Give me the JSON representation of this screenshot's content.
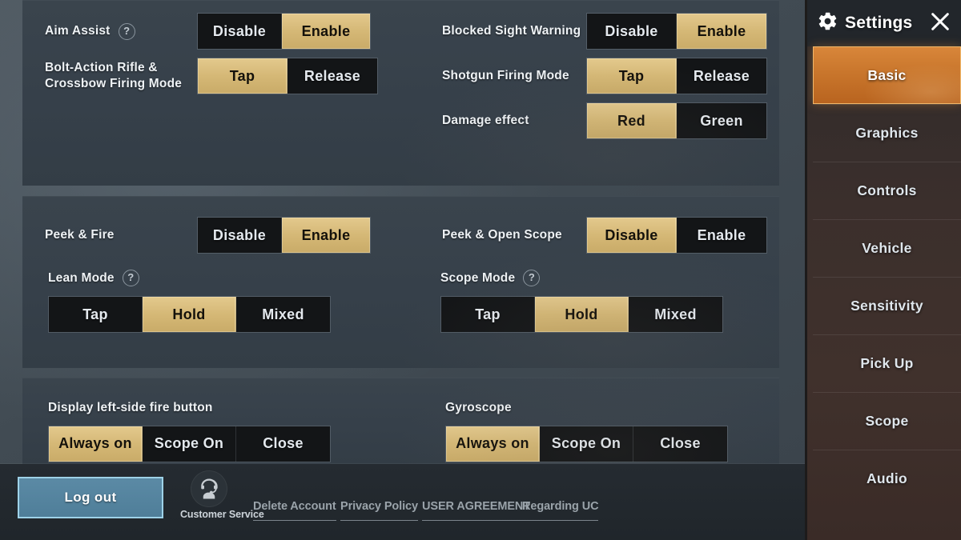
{
  "colors": {
    "gold": "#d5b876",
    "panel_bg": "#36404a",
    "sidebar_active": "#c9762c",
    "logout_blue": "#4f7e99"
  },
  "sidebar": {
    "title": "Settings",
    "gear_icon": "gear-icon",
    "close_icon": "close-icon",
    "items": [
      {
        "label": "Basic",
        "active": true
      },
      {
        "label": "Graphics",
        "active": false
      },
      {
        "label": "Controls",
        "active": false
      },
      {
        "label": "Vehicle",
        "active": false
      },
      {
        "label": "Sensitivity",
        "active": false
      },
      {
        "label": "Pick Up",
        "active": false
      },
      {
        "label": "Scope",
        "active": false
      },
      {
        "label": "Audio",
        "active": false
      }
    ]
  },
  "panels": [
    {
      "left": [
        {
          "label": "Aim Assist",
          "help": "?",
          "options": [
            {
              "text": "Disable",
              "selected": false
            },
            {
              "text": "Enable",
              "selected": true
            }
          ]
        },
        {
          "label": "Bolt-Action Rifle &\nCrossbow Firing Mode",
          "help": null,
          "options": [
            {
              "text": "Tap",
              "selected": true
            },
            {
              "text": "Release",
              "selected": false
            }
          ]
        }
      ],
      "right": [
        {
          "label": "Blocked Sight Warning",
          "help": null,
          "options": [
            {
              "text": "Disable",
              "selected": false
            },
            {
              "text": "Enable",
              "selected": true
            }
          ]
        },
        {
          "label": "Shotgun Firing Mode",
          "help": null,
          "options": [
            {
              "text": "Tap",
              "selected": true
            },
            {
              "text": "Release",
              "selected": false
            }
          ]
        },
        {
          "label": "Damage effect",
          "help": null,
          "options": [
            {
              "text": "Red",
              "selected": true
            },
            {
              "text": "Green",
              "selected": false
            }
          ]
        }
      ]
    },
    {
      "left": [
        {
          "label": "Peek & Fire",
          "help": null,
          "options": [
            {
              "text": "Disable",
              "selected": false
            },
            {
              "text": "Enable",
              "selected": true
            }
          ]
        },
        {
          "label": "Lean Mode",
          "help": "?",
          "options": [
            {
              "text": "Tap",
              "selected": false
            },
            {
              "text": "Hold",
              "selected": true
            },
            {
              "text": "Mixed",
              "selected": false
            }
          ]
        }
      ],
      "right": [
        {
          "label": "Peek & Open Scope",
          "help": null,
          "options": [
            {
              "text": "Disable",
              "selected": true
            },
            {
              "text": "Enable",
              "selected": false
            }
          ]
        },
        {
          "label": "Scope Mode",
          "help": "?",
          "options": [
            {
              "text": "Tap",
              "selected": false
            },
            {
              "text": "Hold",
              "selected": true
            },
            {
              "text": "Mixed",
              "selected": false
            }
          ]
        }
      ]
    },
    {
      "left": [
        {
          "label": "Display left-side fire button",
          "help": null,
          "options": [
            {
              "text": "Always on",
              "selected": true
            },
            {
              "text": "Scope On",
              "selected": false
            },
            {
              "text": "Close",
              "selected": false
            }
          ]
        }
      ],
      "right": [
        {
          "label": "Gyroscope",
          "help": null,
          "options": [
            {
              "text": "Always on",
              "selected": true
            },
            {
              "text": "Scope On",
              "selected": false
            },
            {
              "text": "Close",
              "selected": false
            }
          ]
        }
      ]
    }
  ],
  "footer": {
    "logout_label": "Log out",
    "customer_service_label": "Customer Service",
    "customer_service_icon": "headset-support-icon",
    "links": [
      {
        "label": "Delete Account"
      },
      {
        "label": "Privacy Policy"
      },
      {
        "label": "USER AGREEMENT"
      },
      {
        "label": "Regarding UC"
      }
    ]
  }
}
